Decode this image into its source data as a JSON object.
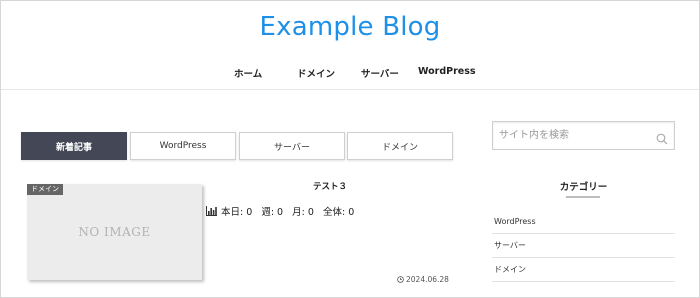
{
  "header": {
    "site_title": "Example Blog",
    "nav": [
      {
        "label": "ホーム"
      },
      {
        "label": "ドメイン"
      },
      {
        "label": "サーバー"
      },
      {
        "label": "WordPress"
      }
    ]
  },
  "tabs": [
    {
      "label": "新着記事",
      "active": true
    },
    {
      "label": "WordPress",
      "active": false
    },
    {
      "label": "サーバー",
      "active": false
    },
    {
      "label": "ドメイン",
      "active": false
    }
  ],
  "post": {
    "category_label": "ドメイン",
    "thumbnail_text": "NO IMAGE",
    "title": "テスト３",
    "pv_text": "本日: 0   週: 0   月: 0   全体: 0",
    "date": "2024.06.28"
  },
  "sidebar": {
    "search_placeholder": "サイト内を検索",
    "widget_title": "カテゴリー",
    "categories": [
      {
        "label": "WordPress"
      },
      {
        "label": "サーバー"
      },
      {
        "label": "ドメイン"
      }
    ]
  },
  "colors": {
    "brand": "#1e90e8",
    "active_tab": "#434756"
  },
  "icons": {
    "pv": "bar-chart-icon",
    "date": "clock-icon",
    "search": "search-icon"
  }
}
